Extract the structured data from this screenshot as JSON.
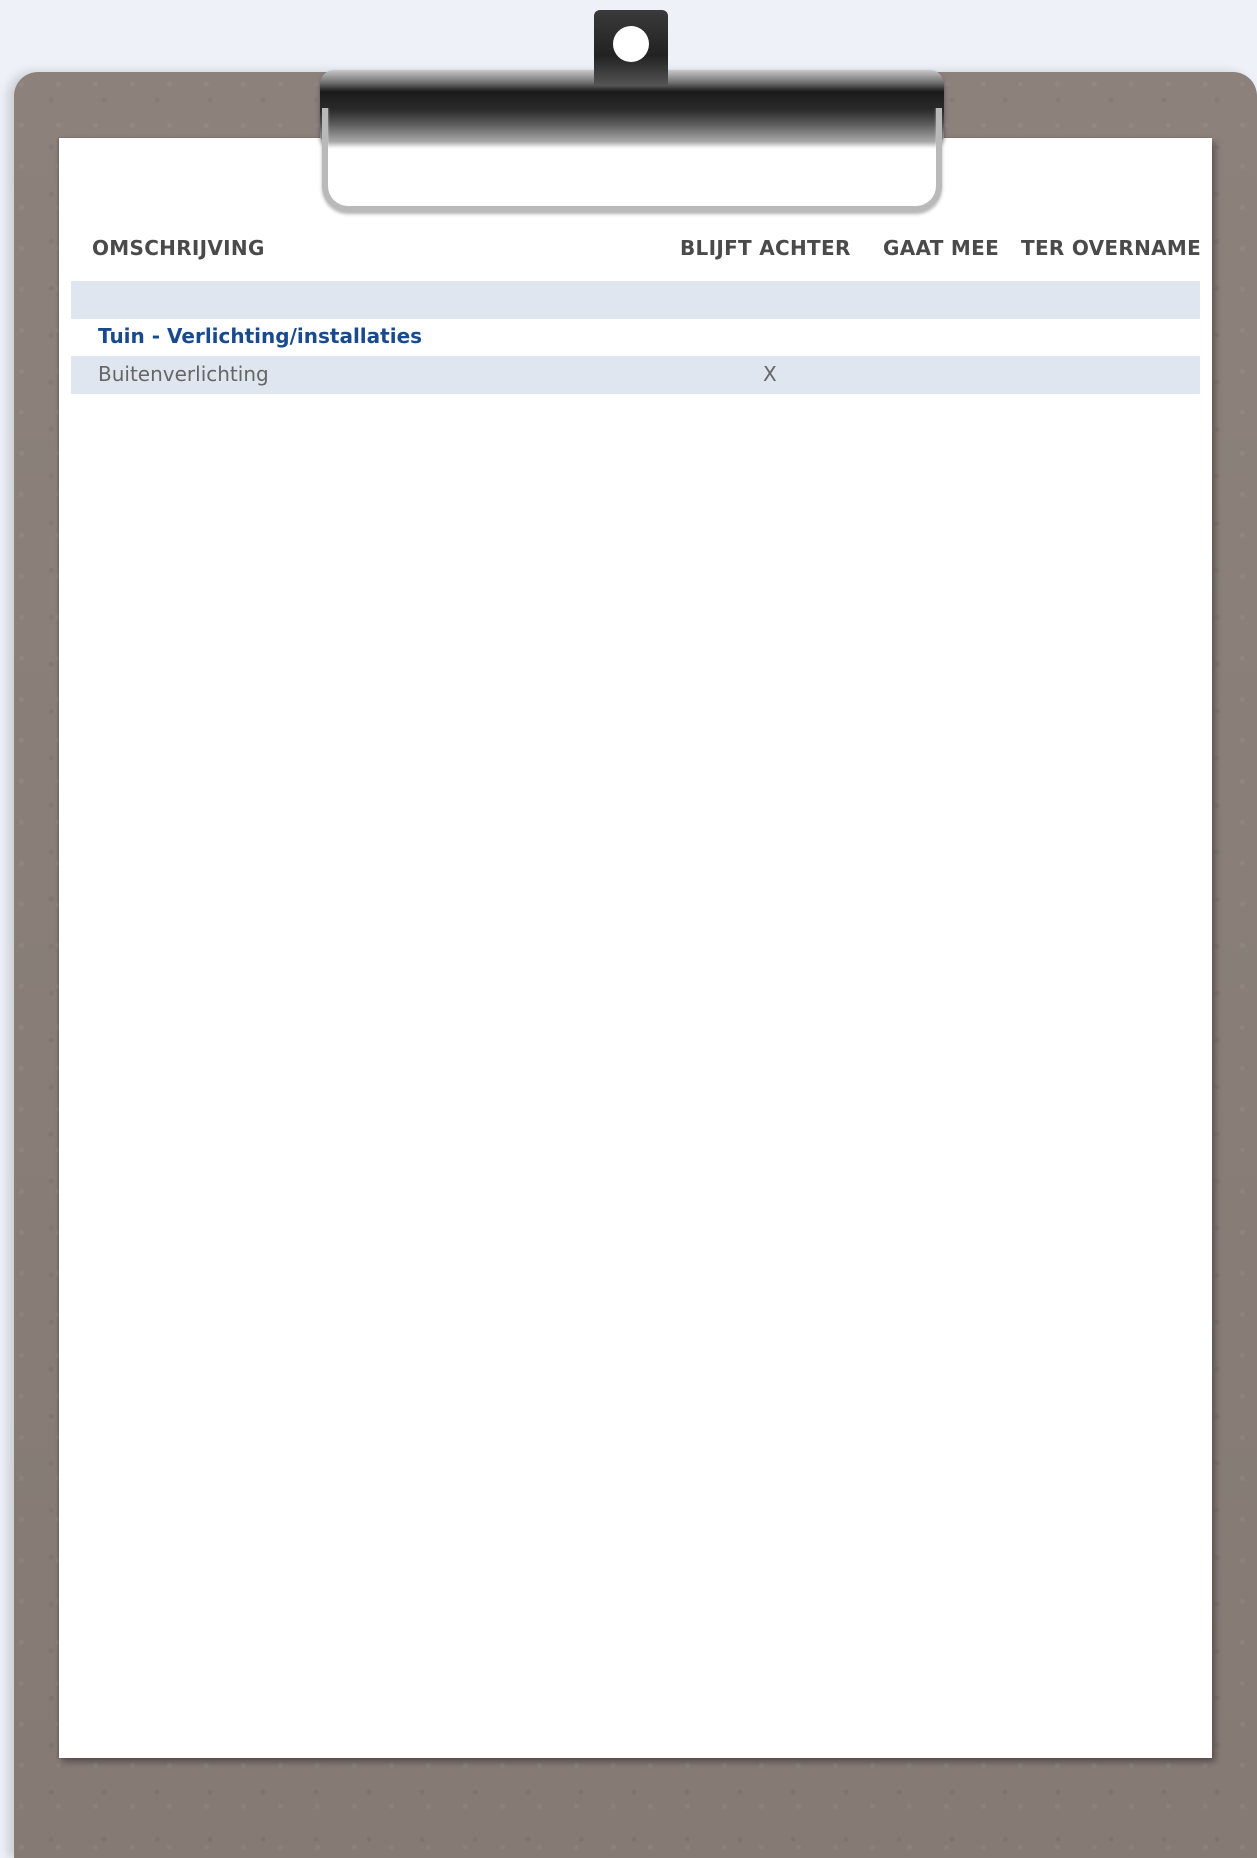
{
  "columns": {
    "description": "OMSCHRIJVING",
    "stays": "BLIJFT ACHTER",
    "goes": "GAAT MEE",
    "takeover": "TER OVERNAME"
  },
  "groups": [
    {
      "title": "Tuin - Verlichting/installaties",
      "items": [
        {
          "label": "Buitenverlichting",
          "blijft_achter": "X",
          "gaat_mee": "",
          "ter_overname": ""
        }
      ]
    }
  ],
  "colors": {
    "header_text": "#4a4a4a",
    "group_title": "#1a4a8e",
    "row_band": "#dfe6ef",
    "board": "#8a7e78",
    "background": "#eef1f8"
  }
}
